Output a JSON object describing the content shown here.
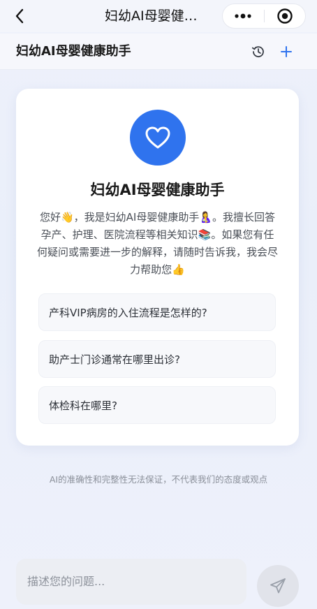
{
  "topnav": {
    "title": "妇幼AI母婴健…",
    "back_icon": "chevron-left-icon",
    "more_icon": "more-dots-icon",
    "target_icon": "target-icon"
  },
  "header": {
    "title": "妇幼AI母婴健康助手",
    "history_icon": "history-icon",
    "add_icon": "plus-icon"
  },
  "card": {
    "icon": "heart-icon",
    "title": "妇幼AI母婴健康助手",
    "intro": "您好👋，我是妇幼AI母婴健康助手🤱。我擅长回答孕产、护理、医院流程等相关知识📚。如果您有任何疑问或需要进一步的解释，请随时告诉我，我会尽力帮助您👍",
    "suggestions": [
      "产科VIP病房的入住流程是怎样的?",
      "助产士门诊通常在哪里出诊?",
      "体检科在哪里?"
    ]
  },
  "disclaimer": "AI的准确性和完整性无法保证，不代表我们的态度或观点",
  "input": {
    "placeholder": "描述您的问题...",
    "send_icon": "send-icon"
  },
  "colors": {
    "accent": "#2f73ee",
    "background": "#eef1fb"
  }
}
